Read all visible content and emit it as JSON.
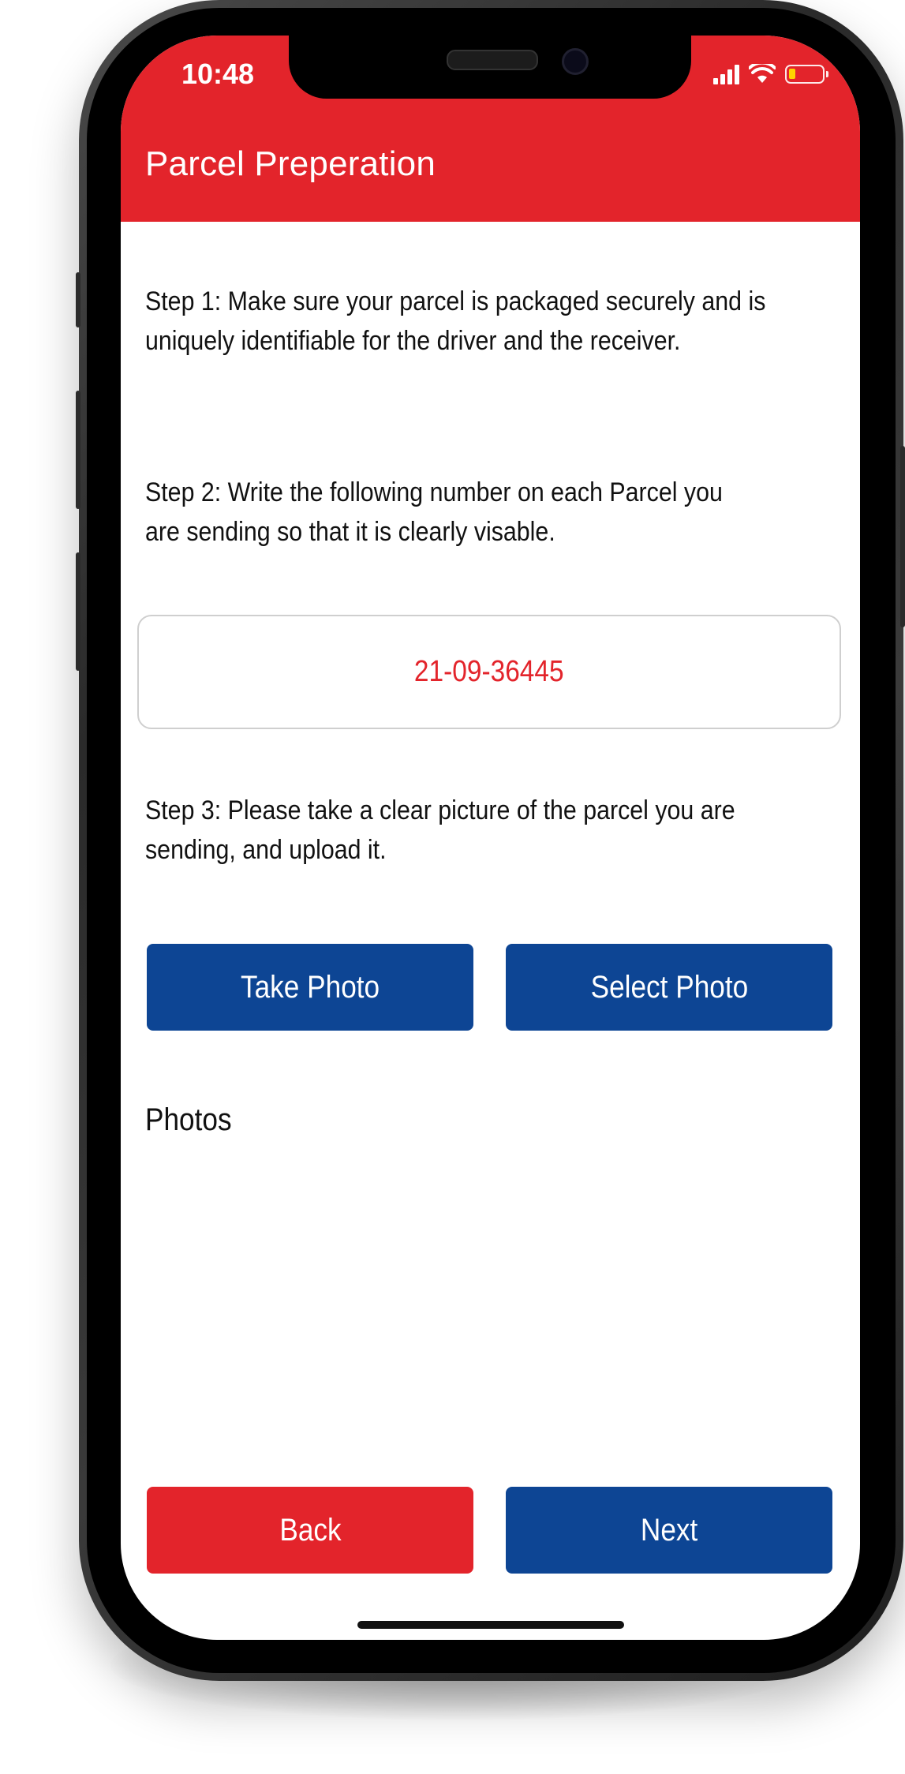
{
  "status_bar": {
    "time": "10:48"
  },
  "header": {
    "title": "Parcel Preperation"
  },
  "steps": {
    "step1": "Step 1: Make sure your parcel is packaged securely and is\nuniquely identifiable for the driver and the receiver.",
    "step2": "Step 2: Write the following number on each Parcel you\nare sending so that it is clearly visable.",
    "parcel_number": "21-09-36445",
    "step3": "Step 3: Please take a clear picture of the parcel you are\nsending, and upload it."
  },
  "photo_actions": {
    "take_photo": "Take Photo",
    "select_photo": "Select Photo"
  },
  "photos": {
    "label": "Photos",
    "items": []
  },
  "footer": {
    "back": "Back",
    "next": "Next"
  },
  "colors": {
    "brand_red": "#e3242b",
    "brand_blue": "#0d4594"
  },
  "icons": [
    "signal-icon",
    "wifi-icon",
    "battery-icon"
  ]
}
